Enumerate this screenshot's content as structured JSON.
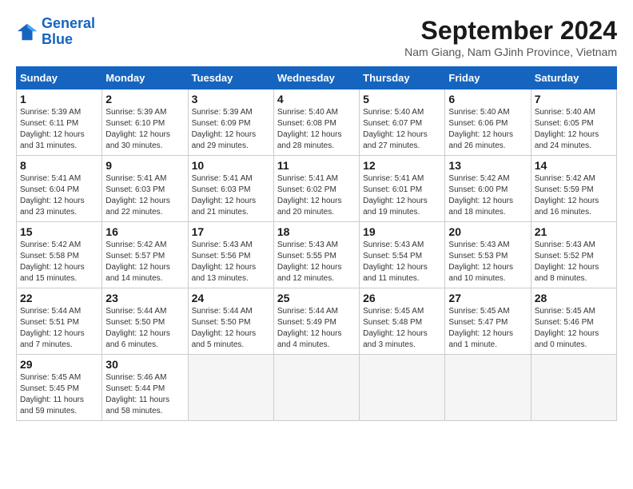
{
  "logo": {
    "line1": "General",
    "line2": "Blue"
  },
  "title": "September 2024",
  "subtitle": "Nam Giang, Nam GJinh Province, Vietnam",
  "headers": [
    "Sunday",
    "Monday",
    "Tuesday",
    "Wednesday",
    "Thursday",
    "Friday",
    "Saturday"
  ],
  "weeks": [
    [
      {
        "day": "1",
        "info": "Sunrise: 5:39 AM\nSunset: 6:11 PM\nDaylight: 12 hours\nand 31 minutes."
      },
      {
        "day": "2",
        "info": "Sunrise: 5:39 AM\nSunset: 6:10 PM\nDaylight: 12 hours\nand 30 minutes."
      },
      {
        "day": "3",
        "info": "Sunrise: 5:39 AM\nSunset: 6:09 PM\nDaylight: 12 hours\nand 29 minutes."
      },
      {
        "day": "4",
        "info": "Sunrise: 5:40 AM\nSunset: 6:08 PM\nDaylight: 12 hours\nand 28 minutes."
      },
      {
        "day": "5",
        "info": "Sunrise: 5:40 AM\nSunset: 6:07 PM\nDaylight: 12 hours\nand 27 minutes."
      },
      {
        "day": "6",
        "info": "Sunrise: 5:40 AM\nSunset: 6:06 PM\nDaylight: 12 hours\nand 26 minutes."
      },
      {
        "day": "7",
        "info": "Sunrise: 5:40 AM\nSunset: 6:05 PM\nDaylight: 12 hours\nand 24 minutes."
      }
    ],
    [
      {
        "day": "8",
        "info": "Sunrise: 5:41 AM\nSunset: 6:04 PM\nDaylight: 12 hours\nand 23 minutes."
      },
      {
        "day": "9",
        "info": "Sunrise: 5:41 AM\nSunset: 6:03 PM\nDaylight: 12 hours\nand 22 minutes."
      },
      {
        "day": "10",
        "info": "Sunrise: 5:41 AM\nSunset: 6:03 PM\nDaylight: 12 hours\nand 21 minutes."
      },
      {
        "day": "11",
        "info": "Sunrise: 5:41 AM\nSunset: 6:02 PM\nDaylight: 12 hours\nand 20 minutes."
      },
      {
        "day": "12",
        "info": "Sunrise: 5:41 AM\nSunset: 6:01 PM\nDaylight: 12 hours\nand 19 minutes."
      },
      {
        "day": "13",
        "info": "Sunrise: 5:42 AM\nSunset: 6:00 PM\nDaylight: 12 hours\nand 18 minutes."
      },
      {
        "day": "14",
        "info": "Sunrise: 5:42 AM\nSunset: 5:59 PM\nDaylight: 12 hours\nand 16 minutes."
      }
    ],
    [
      {
        "day": "15",
        "info": "Sunrise: 5:42 AM\nSunset: 5:58 PM\nDaylight: 12 hours\nand 15 minutes."
      },
      {
        "day": "16",
        "info": "Sunrise: 5:42 AM\nSunset: 5:57 PM\nDaylight: 12 hours\nand 14 minutes."
      },
      {
        "day": "17",
        "info": "Sunrise: 5:43 AM\nSunset: 5:56 PM\nDaylight: 12 hours\nand 13 minutes."
      },
      {
        "day": "18",
        "info": "Sunrise: 5:43 AM\nSunset: 5:55 PM\nDaylight: 12 hours\nand 12 minutes."
      },
      {
        "day": "19",
        "info": "Sunrise: 5:43 AM\nSunset: 5:54 PM\nDaylight: 12 hours\nand 11 minutes."
      },
      {
        "day": "20",
        "info": "Sunrise: 5:43 AM\nSunset: 5:53 PM\nDaylight: 12 hours\nand 10 minutes."
      },
      {
        "day": "21",
        "info": "Sunrise: 5:43 AM\nSunset: 5:52 PM\nDaylight: 12 hours\nand 8 minutes."
      }
    ],
    [
      {
        "day": "22",
        "info": "Sunrise: 5:44 AM\nSunset: 5:51 PM\nDaylight: 12 hours\nand 7 minutes."
      },
      {
        "day": "23",
        "info": "Sunrise: 5:44 AM\nSunset: 5:50 PM\nDaylight: 12 hours\nand 6 minutes."
      },
      {
        "day": "24",
        "info": "Sunrise: 5:44 AM\nSunset: 5:50 PM\nDaylight: 12 hours\nand 5 minutes."
      },
      {
        "day": "25",
        "info": "Sunrise: 5:44 AM\nSunset: 5:49 PM\nDaylight: 12 hours\nand 4 minutes."
      },
      {
        "day": "26",
        "info": "Sunrise: 5:45 AM\nSunset: 5:48 PM\nDaylight: 12 hours\nand 3 minutes."
      },
      {
        "day": "27",
        "info": "Sunrise: 5:45 AM\nSunset: 5:47 PM\nDaylight: 12 hours\nand 1 minute."
      },
      {
        "day": "28",
        "info": "Sunrise: 5:45 AM\nSunset: 5:46 PM\nDaylight: 12 hours\nand 0 minutes."
      }
    ],
    [
      {
        "day": "29",
        "info": "Sunrise: 5:45 AM\nSunset: 5:45 PM\nDaylight: 11 hours\nand 59 minutes."
      },
      {
        "day": "30",
        "info": "Sunrise: 5:46 AM\nSunset: 5:44 PM\nDaylight: 11 hours\nand 58 minutes."
      },
      {
        "day": "",
        "info": ""
      },
      {
        "day": "",
        "info": ""
      },
      {
        "day": "",
        "info": ""
      },
      {
        "day": "",
        "info": ""
      },
      {
        "day": "",
        "info": ""
      }
    ]
  ]
}
